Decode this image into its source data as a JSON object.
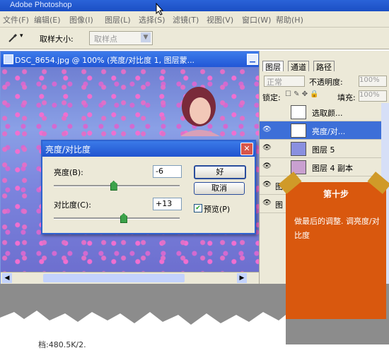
{
  "app": {
    "title": "Adobe Photoshop"
  },
  "menu": [
    "文件(F)",
    "编辑(E)",
    "图像(I)",
    "图层(L)",
    "选择(S)",
    "滤镜(T)",
    "视图(V)",
    "窗口(W)",
    "帮助(H)"
  ],
  "options": {
    "sample_size_label": "取样大小:",
    "sample_size_value": "取样点"
  },
  "document": {
    "title": "DSC_8654.jpg @ 100% (亮度/对比度 1, 图层蒙..."
  },
  "layers_panel": {
    "tabs": [
      "图层",
      "通道",
      "路径"
    ],
    "blend_mode": "正常",
    "opacity_label": "不透明度:",
    "opacity_value": "100%",
    "lock_label": "锁定:",
    "fill_label": "填充:",
    "fill_value": "100%",
    "layers": [
      {
        "name": "选取颜..."
      },
      {
        "name": "亮度/对..."
      },
      {
        "name": "图层 5"
      },
      {
        "name": "图层 4 副本"
      },
      {
        "name": "图"
      },
      {
        "name": "图"
      }
    ]
  },
  "dialog": {
    "title": "亮度/对比度",
    "brightness_label": "亮度(B):",
    "brightness_value": "-6",
    "contrast_label": "对比度(C):",
    "contrast_value": "+13",
    "ok_label": "好",
    "cancel_label": "取消",
    "preview_label": "预览(P)",
    "preview_checked": true,
    "brightness_slider_fraction": 0.47,
    "contrast_slider_fraction": 0.55
  },
  "note": {
    "heading": "第十步",
    "body": "做最后的调整. 调亮度/对比度"
  },
  "status": {
    "text": "档:480.5K/2."
  },
  "colors": {
    "accent": "#2054cf",
    "note_bg": "#d9580e",
    "tape": "#d09a28"
  }
}
